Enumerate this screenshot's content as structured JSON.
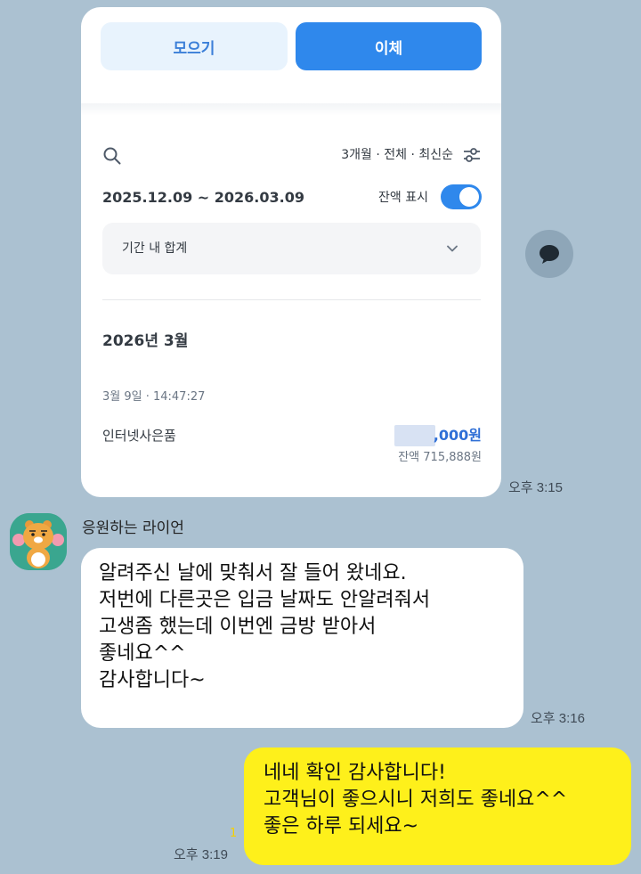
{
  "card": {
    "save_button": "모으기",
    "transfer_button": "이체",
    "filter_text": "3개월 · 전체 · 최신순",
    "date_range": "2025.12.09 ~ 2026.03.09",
    "balance_toggle_label": "잔액 표시",
    "balance_toggle_on": true,
    "period_total_label": "기간 내 합계",
    "month_heading": "2026년 3월",
    "transaction": {
      "datetime": "3월 9일 · 14:47:27",
      "description": "인터넷사은품",
      "amount_visible": ",000원",
      "balance": "잔액 715,888원"
    },
    "colors": {
      "accent": "#2f88ec",
      "amount": "#2f6fd6"
    }
  },
  "chat": {
    "time_card": "오후 3:15",
    "sender_name": "응원하는 라이언",
    "incoming_lines": [
      "알려주신 날에 맞춰서 잘 들어 왔네요.",
      "저번에 다른곳은 입금 날짜도 안알려줘서",
      "고생좀 했는데 이번엔 금방 받아서",
      "좋네요^^",
      "감사합니다~"
    ],
    "time_incoming": "오후 3:16",
    "outgoing_lines": [
      "네네 확인 감사합니다!",
      "고객님이 좋으시니 저희도 좋네요^^",
      "좋은 하루 되세요~"
    ],
    "unread_count": "1",
    "time_outgoing": "오후 3:19",
    "colors": {
      "background": "#abc1d1",
      "my_bubble": "#fef01b"
    }
  }
}
